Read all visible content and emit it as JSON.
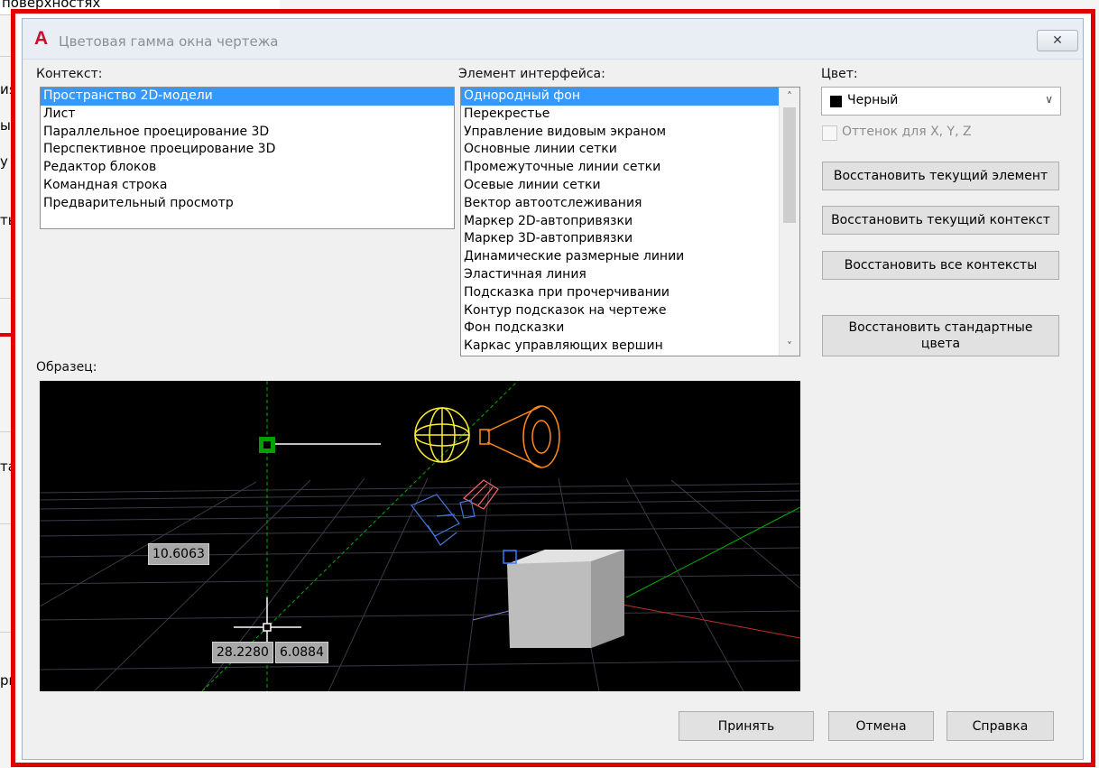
{
  "background_app": {
    "top_text": "поверхностях",
    "fragments": [
      "ия",
      "ы",
      "у",
      "ть",
      "та",
      "ри"
    ]
  },
  "dialog": {
    "title": "Цветовая гамма окна чертежа",
    "app_icon": "autocad-logo",
    "close_glyph": "✕"
  },
  "context": {
    "label": "Контекст:",
    "items": [
      "Пространство 2D-модели",
      "Лист",
      "Параллельное проецирование 3D",
      "Перспективное проецирование 3D",
      "Редактор блоков",
      "Командная строка",
      "Предварительный просмотр"
    ],
    "selected": "Пространство 2D-модели"
  },
  "interface": {
    "label": "Элемент интерфейса:",
    "items": [
      "Однородный фон",
      "Перекрестье",
      "Управление видовым экраном",
      "Основные линии сетки",
      "Промежуточные линии сетки",
      "Осевые линии сетки",
      "Вектор автоотслеживания",
      "Маркер 2D-автопривязки",
      "Маркер 3D-автопривязки",
      "Динамические размерные линии",
      "Эластичная линия",
      "Подсказка при прочерчивании",
      "Контур подсказок на чертеже",
      "Фон подсказки",
      "Каркас управляющих вершин"
    ],
    "selected": "Однородный фон"
  },
  "color": {
    "label": "Цвет:",
    "value": "Черный",
    "swatch": "#000000",
    "tint_label": "Оттенок для X, Y, Z",
    "tint_checked": false
  },
  "buttons": {
    "restore_element": "Восстановить текущий элемент",
    "restore_context": "Восстановить текущий контекст",
    "restore_all": "Восстановить все контексты",
    "restore_default": "Восстановить стандартные цвета",
    "ok": "Принять",
    "cancel": "Отмена",
    "help": "Справка"
  },
  "preview": {
    "label": "Образец:",
    "dim_value": "10.6063",
    "coord_x": "28.2280",
    "coord_y": "6.0884"
  },
  "colors": {
    "frame_red": "#e00000",
    "selection_blue": "#3399ff",
    "grip_green": "#00aa00",
    "light_yellow": "#ffee33",
    "camera_orange": "#ff8a1a"
  }
}
